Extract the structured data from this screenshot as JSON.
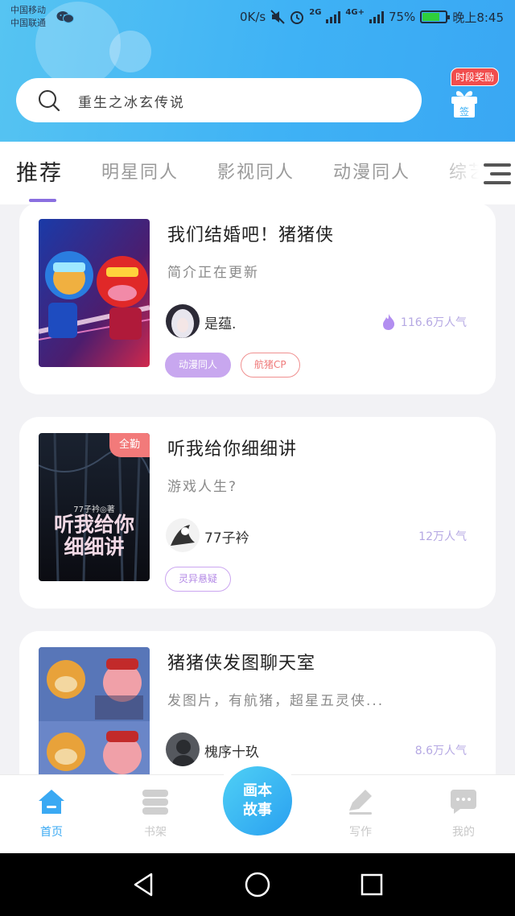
{
  "status_bar": {
    "carrier1": "中国移动",
    "carrier2": "中国联通",
    "speed": "0K/s",
    "network_2g": "2G",
    "network_4g": "4G+",
    "battery": "75%",
    "time": "晚上8:45"
  },
  "search": {
    "text": "重生之冰玄传说"
  },
  "sign_in": {
    "badge": "时段奖励",
    "label": "签"
  },
  "tabs": [
    "推荐",
    "明星同人",
    "影视同人",
    "动漫同人",
    "综艺"
  ],
  "stories": [
    {
      "title": "我们结婚吧！猪猪侠",
      "description": "简介正在更新",
      "author": "是蕴.",
      "popularity": "116.6万人气",
      "tags": [
        "动漫同人",
        "航猪CP"
      ],
      "ribbon": ""
    },
    {
      "title": "听我给你细细讲",
      "description": "游戏人生?",
      "author": "77子衿",
      "popularity": "12万人气",
      "tags": [
        "灵异悬疑"
      ],
      "ribbon": "全勤",
      "cover_text": "听我给你细细讲",
      "cover_author": "77子衿◎著"
    },
    {
      "title": "猪猪侠发图聊天室",
      "description": "发图片，有航猪，超星五灵侠...",
      "author": "槐序十玖",
      "popularity": "8.6万人气",
      "tags": [],
      "ribbon": ""
    }
  ],
  "bottom_nav": {
    "home": "首页",
    "shelf": "书架",
    "center": "画本故事",
    "write": "写作",
    "mine": "我的"
  },
  "colors": {
    "accent": "#3aa9f3",
    "tab_indicator": "#8a6fe0",
    "tag_purple": "#c8a7ef"
  }
}
